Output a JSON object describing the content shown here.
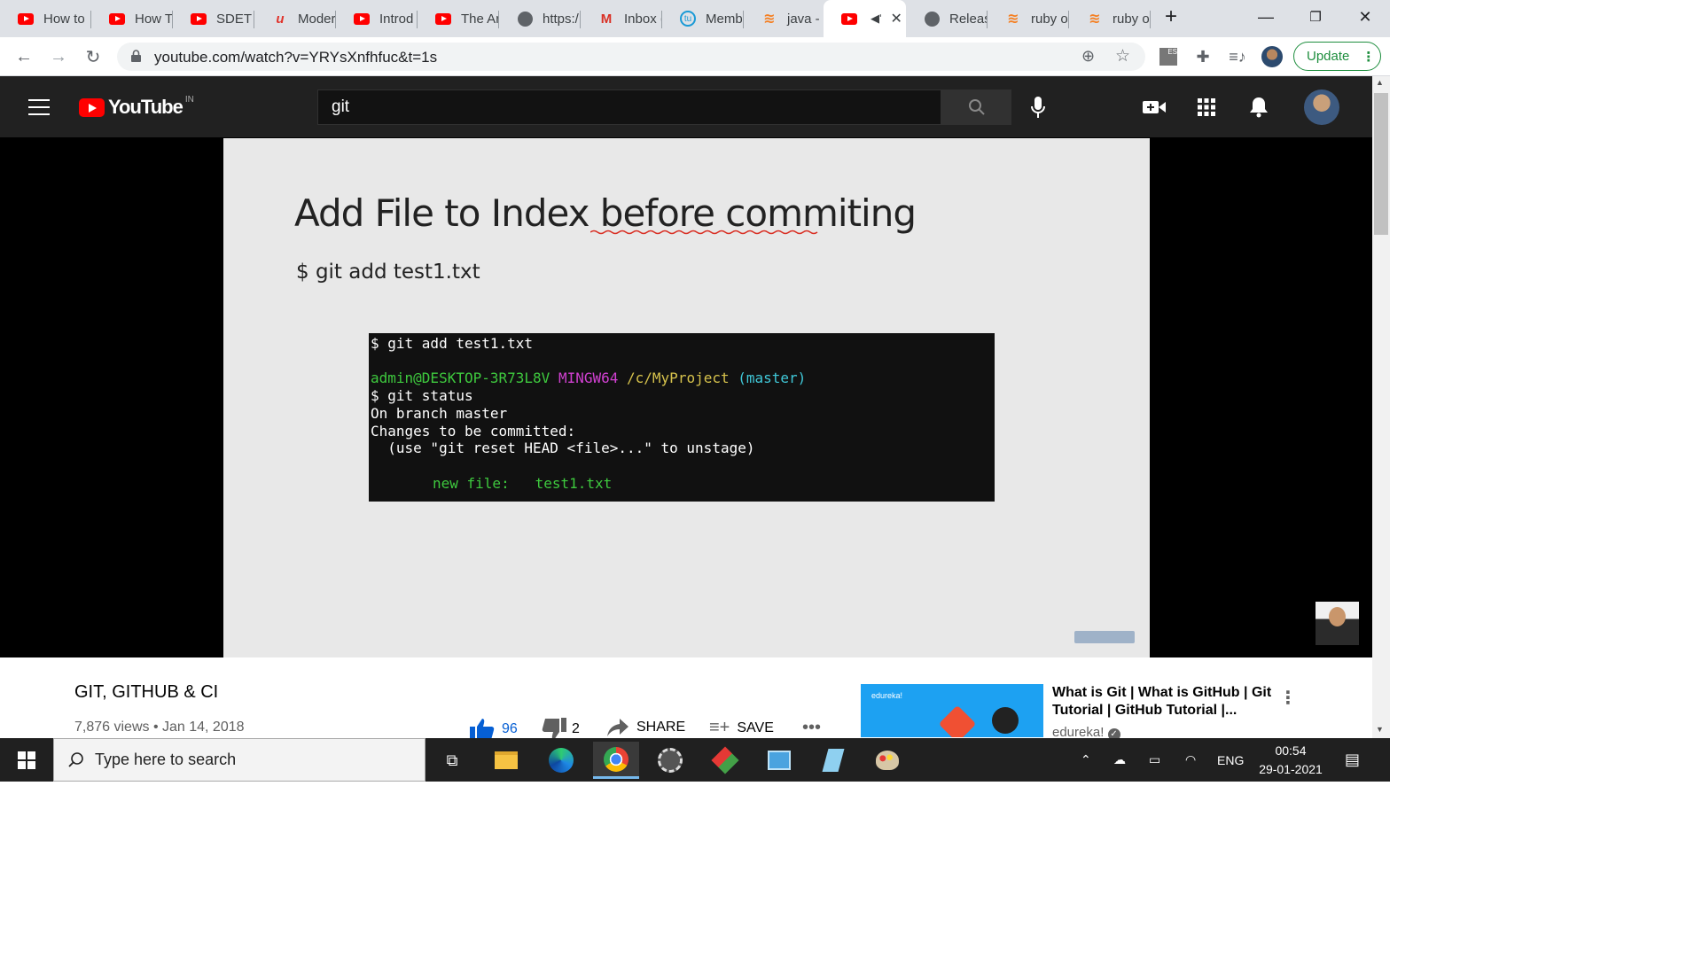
{
  "browser": {
    "tabs": [
      {
        "title": "How to",
        "icon": "youtube-icon"
      },
      {
        "title": "How To",
        "icon": "youtube-icon"
      },
      {
        "title": "SDET -",
        "icon": "youtube-icon"
      },
      {
        "title": "Moder",
        "icon": "udemy-icon"
      },
      {
        "title": "Introd",
        "icon": "youtube-icon"
      },
      {
        "title": "The Ar",
        "icon": "youtube-icon"
      },
      {
        "title": "https:/",
        "icon": "globe-icon"
      },
      {
        "title": "Inbox (",
        "icon": "gmail-icon"
      },
      {
        "title": "Memb",
        "icon": "site-icon"
      },
      {
        "title": "java - (",
        "icon": "stackoverflow-icon"
      },
      {
        "title": "",
        "icon": "youtube-icon",
        "active": true
      },
      {
        "title": "Releas",
        "icon": "globe-icon"
      },
      {
        "title": "ruby o",
        "icon": "stackoverflow-icon"
      },
      {
        "title": "ruby o",
        "icon": "stackoverflow-icon"
      }
    ],
    "url": "youtube.com/watch?v=YRYsXnfhfuc&t=1s",
    "update_label": "Update"
  },
  "youtube": {
    "logo_text": "YouTube",
    "country_code": "IN",
    "search_value": "git"
  },
  "slide": {
    "title": "Add File to Index before commiting",
    "command": "$ git add test1.txt",
    "terminal": {
      "line1": "$ git add test1.txt",
      "prompt_user": "admin@DESKTOP-3R73L8V",
      "prompt_env": "MINGW64",
      "prompt_path": "/c/MyProject",
      "prompt_branch": "(master)",
      "line3": "$ git status",
      "line4": "On branch master",
      "line5": "Changes to be committed:",
      "line6": "  (use \"git reset HEAD <file>...\" to unstage)",
      "line7_label": "new file:",
      "line7_file": "test1.txt"
    }
  },
  "video": {
    "title": "GIT, GITHUB & CI",
    "meta": "7,876 views • Jan 14, 2018",
    "likes": "96",
    "dislikes": "2",
    "share_label": "SHARE",
    "save_label": "SAVE"
  },
  "recommended": {
    "title": "What is Git | What is GitHub | Git Tutorial | GitHub Tutorial |...",
    "channel": "edureka!",
    "thumb_tag": "edureka!"
  },
  "taskbar": {
    "search_placeholder": "Type here to search",
    "language": "ENG",
    "time": "00:54",
    "date": "29-01-2021"
  }
}
